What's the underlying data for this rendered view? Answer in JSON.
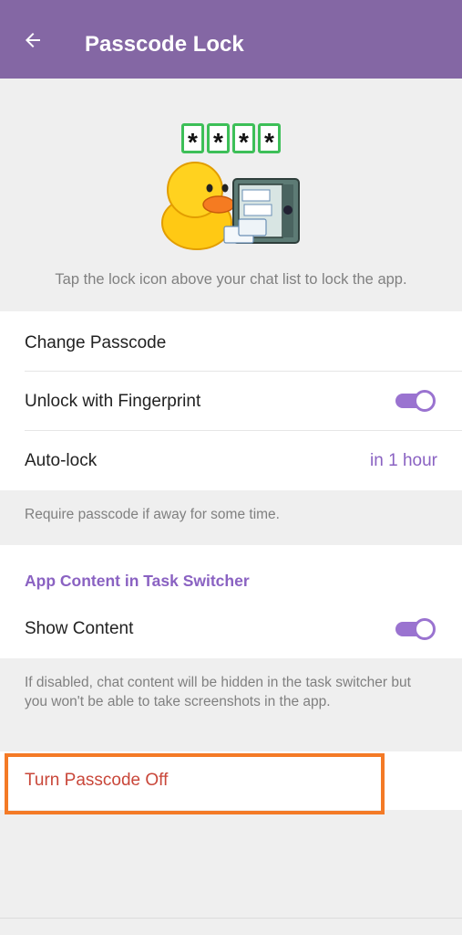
{
  "header": {
    "title": "Passcode Lock",
    "back_icon": "arrow-left-icon",
    "background_color": "#8467a4"
  },
  "hero": {
    "pin_chars": [
      "*",
      "*",
      "*",
      "*"
    ],
    "sticker_icon": "duck-with-safe-sticker",
    "hint": "Tap the lock icon above your chat list to lock the app."
  },
  "settings": {
    "change_passcode": "Change Passcode",
    "unlock_fingerprint": "Unlock with Fingerprint",
    "unlock_fingerprint_enabled": true,
    "auto_lock_label": "Auto-lock",
    "auto_lock_value": "in 1 hour",
    "auto_lock_note": "Require passcode if away for some time."
  },
  "task_switcher": {
    "section_title": "App Content in Task Switcher",
    "show_content": "Show Content",
    "show_content_enabled": true,
    "note": "If disabled, chat content will be hidden in the task switcher but you won't be able to take screenshots in the app."
  },
  "danger": {
    "turn_off": "Turn Passcode Off"
  },
  "colors": {
    "accent": "#8a62c2",
    "danger": "#c9473a",
    "highlight": "#f47a26"
  }
}
